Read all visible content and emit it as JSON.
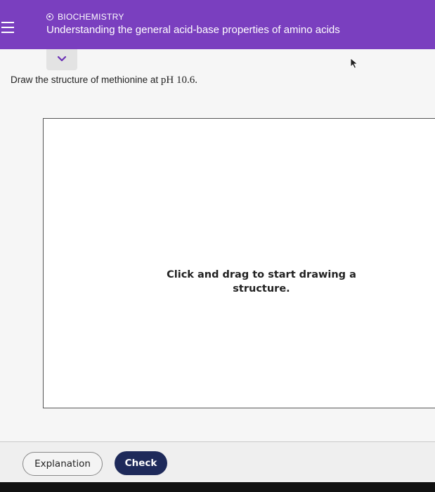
{
  "header": {
    "course_label": "BIOCHEMISTRY",
    "topic_title": "Understanding the general acid-base properties of amino acids",
    "background_color": "#7a3fbf"
  },
  "question": {
    "text": "Draw the structure of methionine at ",
    "ph_text": "pH 10.6."
  },
  "canvas": {
    "hint": "Click and drag to start drawing a structure."
  },
  "footer": {
    "explanation_label": "Explanation",
    "check_label": "Check",
    "check_color": "#1e2a5a"
  },
  "icons": {
    "menu": "hamburger-menu-icon",
    "course": "course-circle-icon",
    "collapse": "chevron-down-icon",
    "cursor": "mouse-pointer-icon"
  }
}
